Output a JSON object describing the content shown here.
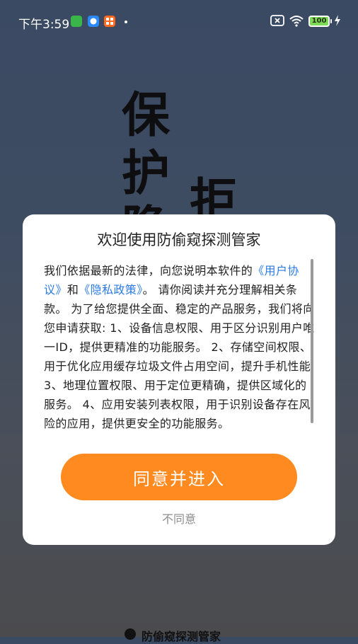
{
  "status_bar": {
    "time": "下午3:59",
    "battery_level": "100",
    "icons": [
      "app-green-icon",
      "app-blue-chat-icon",
      "app-orange-icon",
      "sim-missing-icon",
      "wifi-icon",
      "battery-icon",
      "charging-icon"
    ],
    "colors": {
      "app_green": "#39b54a",
      "app_blue": "#2b8af7",
      "app_orange": "#ff6a1e",
      "battery": "#7ed957"
    }
  },
  "background": {
    "chars": [
      "保",
      "护",
      "隐",
      "拒"
    ],
    "bottom_app_name": "防偷窥探测管家"
  },
  "dialog": {
    "title": "欢迎使用防偷窥探测管家",
    "body_intro": "我们依据最新的法律，向您说明本软件的",
    "user_agreement_link": "《用户协议》",
    "body_and": "和",
    "privacy_policy_link": "《隐私政策》",
    "body_rest": "。 请你阅读并充分理解相关条款。 为了给您提供全面、稳定的产品服务，我们将向您申请获取: 1、设备信息权限、用于区分识别用户唯一ID，提供更精准的功能服务。 2、存储空间权限、用于优化应用缓存垃圾文件占用空间，提升手机性能 3、地理位置权限、用于定位更精确，提供区域化的服务。 4、应用安装列表权限，用于识别设备存在风险的应用，提供更安全的功能服务。",
    "agree_label": "同意并进入",
    "disagree_label": "不同意",
    "colors": {
      "accent": "#ff8a1f",
      "link": "#2c7be5"
    }
  }
}
